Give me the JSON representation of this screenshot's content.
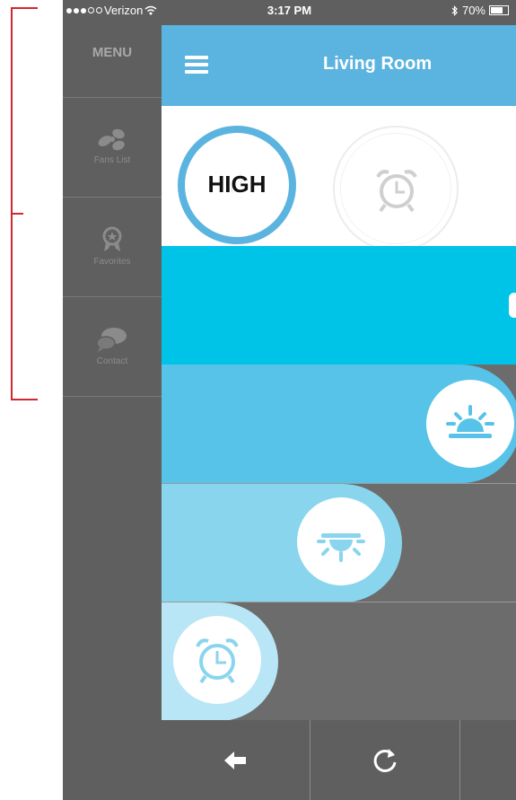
{
  "status_bar": {
    "carrier": "Verizon",
    "time": "3:17 PM",
    "battery": "70%"
  },
  "sidebar": {
    "title": "MENU",
    "items": [
      {
        "label": "Fans List",
        "icon": "fan-icon"
      },
      {
        "label": "Favorites",
        "icon": "ribbon-icon"
      },
      {
        "label": "Contact",
        "icon": "chat-icon"
      }
    ]
  },
  "header": {
    "title": "Living Room",
    "menu_icon": "hamburger-icon"
  },
  "fan": {
    "speed": "HIGH",
    "timer_icon": "alarm-clock-icon"
  },
  "controls": [
    "speed-slider",
    "uplight-slider",
    "downlight-slider",
    "timer-slider"
  ],
  "bottom_bar": {
    "back_icon": "arrow-left-icon",
    "refresh_icon": "refresh-icon"
  },
  "colors": {
    "accent": "#5bb3df",
    "speed_band": "#00c3e8",
    "uplight_band": "#57c3e8",
    "downlight_band": "#89d5ee",
    "timer_band": "#b8e6f6",
    "sidebar": "#5f5f5f",
    "annotation_bracket": "#d0282e"
  }
}
